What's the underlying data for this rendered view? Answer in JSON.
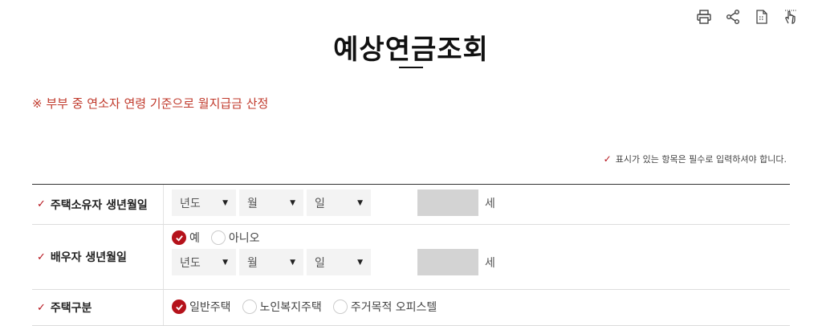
{
  "toolbar": {
    "icons": [
      "print-icon",
      "share-icon",
      "document-edit-icon",
      "hand-touch-icon"
    ]
  },
  "page": {
    "title": "예상연금조회",
    "notice": "※ 부부 중 연소자 연령 기준으로 월지급금 산정",
    "required_note": "표시가 있는 항목은 필수로 입력하셔야 합니다."
  },
  "form": {
    "owner_birth": {
      "label": "주택소유자 생년월일",
      "year": "년도",
      "month": "월",
      "day": "일",
      "age_unit": "세"
    },
    "spouse_birth": {
      "label": "배우자 생년월일",
      "yes": "예",
      "no": "아니오",
      "selected": "예",
      "year": "년도",
      "month": "월",
      "day": "일",
      "age_unit": "세"
    },
    "house_type": {
      "label": "주택구분",
      "options": [
        "일반주택",
        "노인복지주택",
        "주거목적 오피스텔"
      ],
      "selected": "일반주택"
    }
  },
  "colors": {
    "accent": "#b5121b",
    "notice": "#c0392b",
    "select_bg": "#f3f3f3",
    "age_box_bg": "#d3d3d3"
  }
}
